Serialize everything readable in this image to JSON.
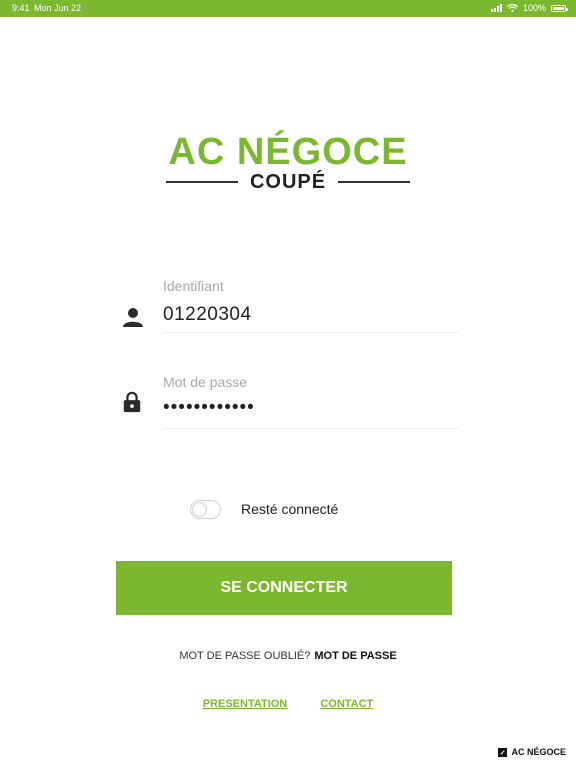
{
  "status_bar": {
    "time": "9:41",
    "date": "Mon Jun 22",
    "battery": "100%"
  },
  "logo": {
    "main": "AC NÉGOCE",
    "sub": "COUPÉ"
  },
  "login": {
    "username_label": "Identifiant",
    "username_value": "01220304",
    "password_label": "Mot de passe",
    "password_value": "••••••••••••"
  },
  "remember": {
    "label": "Resté connecté",
    "enabled": false
  },
  "submit_label": "SE CONNECTER",
  "forgot": {
    "text": "MOT DE PASSE OUBLIÉ?",
    "link": "MOT DE PASSE"
  },
  "footer_links": {
    "presentation": "PRESENTATION",
    "contact": "CONTACT"
  },
  "brand": "AC NÉGOCE",
  "colors": {
    "accent": "#7cb82f",
    "text": "#222222",
    "label": "#a8a8a8"
  }
}
